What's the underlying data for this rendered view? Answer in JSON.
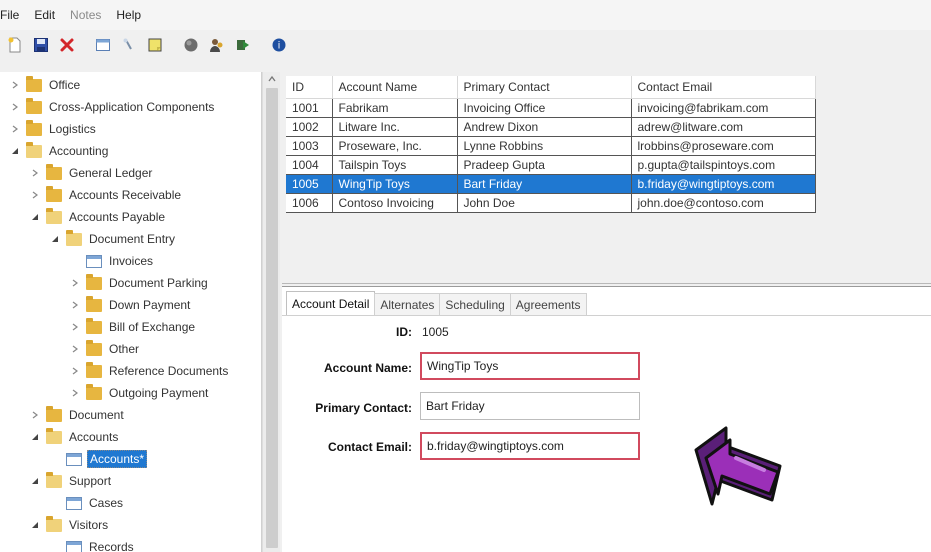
{
  "menu": {
    "items": [
      "File",
      "Edit",
      "Notes",
      "Help"
    ]
  },
  "toolbar": {
    "icons": [
      "new-icon",
      "save-icon",
      "delete-icon",
      "window-icon",
      "search-icon",
      "notes-icon",
      "globe-icon",
      "users-icon",
      "forward-icon",
      "help-icon"
    ]
  },
  "tree": {
    "nodes": [
      {
        "label": "Office",
        "level": 0,
        "expander": "collapsed",
        "icon": "folder"
      },
      {
        "label": "Cross-Application Components",
        "level": 0,
        "expander": "collapsed",
        "icon": "folder"
      },
      {
        "label": "Logistics",
        "level": 0,
        "expander": "collapsed",
        "icon": "folder"
      },
      {
        "label": "Accounting",
        "level": 0,
        "expander": "expanded",
        "icon": "folder-open"
      },
      {
        "label": "General Ledger",
        "level": 1,
        "expander": "collapsed",
        "icon": "folder"
      },
      {
        "label": "Accounts Receivable",
        "level": 1,
        "expander": "collapsed",
        "icon": "folder"
      },
      {
        "label": "Accounts Payable",
        "level": 1,
        "expander": "expanded",
        "icon": "folder-open"
      },
      {
        "label": "Document Entry",
        "level": 2,
        "expander": "expanded",
        "icon": "folder-open"
      },
      {
        "label": "Invoices",
        "level": 3,
        "expander": "none",
        "icon": "document"
      },
      {
        "label": "Document Parking",
        "level": 3,
        "expander": "collapsed",
        "icon": "folder"
      },
      {
        "label": "Down Payment",
        "level": 3,
        "expander": "collapsed",
        "icon": "folder"
      },
      {
        "label": "Bill of Exchange",
        "level": 3,
        "expander": "collapsed",
        "icon": "folder"
      },
      {
        "label": "Other",
        "level": 3,
        "expander": "collapsed",
        "icon": "folder"
      },
      {
        "label": "Reference Documents",
        "level": 3,
        "expander": "collapsed",
        "icon": "folder"
      },
      {
        "label": "Outgoing Payment",
        "level": 3,
        "expander": "collapsed",
        "icon": "folder"
      },
      {
        "label": "Document",
        "level": 1,
        "expander": "collapsed",
        "icon": "folder"
      },
      {
        "label": "Accounts",
        "level": 1,
        "expander": "expanded",
        "icon": "folder-open"
      },
      {
        "label": "Accounts*",
        "level": 2,
        "expander": "none",
        "icon": "document",
        "selected": true
      },
      {
        "label": "Support",
        "level": 1,
        "expander": "expanded",
        "icon": "folder-open"
      },
      {
        "label": "Cases",
        "level": 2,
        "expander": "none",
        "icon": "document"
      },
      {
        "label": "Visitors",
        "level": 1,
        "expander": "expanded",
        "icon": "folder-open"
      },
      {
        "label": "Records",
        "level": 2,
        "expander": "none",
        "icon": "document"
      }
    ]
  },
  "grid": {
    "columns": [
      "ID",
      "Account Name",
      "Primary Contact",
      "Contact Email"
    ],
    "rows": [
      [
        "1001",
        "Fabrikam",
        "Invoicing Office",
        "invoicing@fabrikam.com"
      ],
      [
        "1002",
        "Litware Inc.",
        "Andrew Dixon",
        "adrew@litware.com"
      ],
      [
        "1003",
        "Proseware, Inc.",
        "Lynne Robbins",
        "lrobbins@proseware.com"
      ],
      [
        "1004",
        "Tailspin Toys",
        "Pradeep Gupta",
        "p.gupta@tailspintoys.com"
      ],
      [
        "1005",
        "WingTip Toys",
        "Bart Friday",
        "b.friday@wingtiptoys.com"
      ],
      [
        "1006",
        "Contoso Invoicing",
        "John Doe",
        "john.doe@contoso.com"
      ]
    ],
    "selected_row": 4
  },
  "detail": {
    "tabs": [
      "Account Detail",
      "Alternates",
      "Scheduling",
      "Agreements"
    ],
    "active_tab": 0,
    "id_label": "ID:",
    "id_value": "1005",
    "account_name_label": "Account Name:",
    "account_name_value": "WingTip Toys",
    "primary_contact_label": "Primary Contact:",
    "primary_contact_value": "Bart Friday",
    "contact_email_label": "Contact Email:",
    "contact_email_value": "b.friday@wingtiptoys.com"
  },
  "colors": {
    "selection": "#1f78d1",
    "error_border": "#d14a5e",
    "pointer_purple": "#9b2fb8"
  }
}
